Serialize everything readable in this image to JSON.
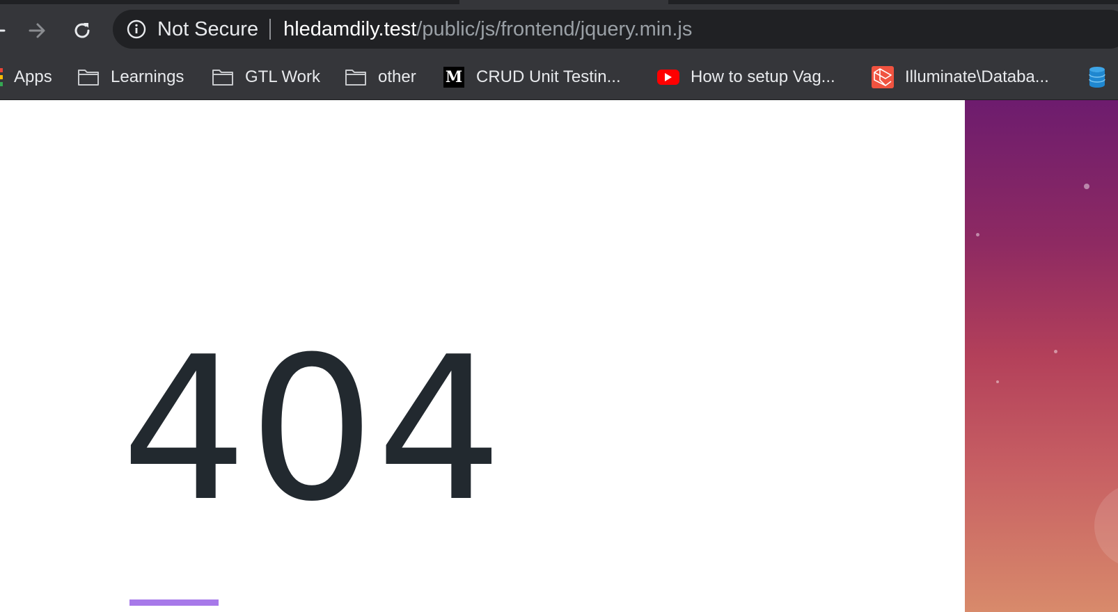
{
  "toolbar": {
    "security_label": "Not Secure",
    "url_host": "hledamdily.test",
    "url_path": "/public/js/frontend/jquery.min.js"
  },
  "bookmarks": {
    "apps": "Apps",
    "learnings": "Learnings",
    "gtl_work": "GTL Work",
    "other": "other",
    "crud": "CRUD Unit Testin...",
    "vagrant": "How to setup Vag...",
    "illuminate": "Illuminate\\Databa..."
  },
  "page": {
    "error_code": "404"
  },
  "icons": {
    "back": "back-arrow-icon",
    "forward": "forward-arrow-icon",
    "reload": "reload-icon",
    "info": "info-icon",
    "apps": "apps-grid-icon",
    "folder": "folder-icon",
    "medium": "medium-icon",
    "youtube": "youtube-icon",
    "laravel": "laravel-icon",
    "database": "database-icon"
  },
  "colors": {
    "chrome_toolbar": "#35363a",
    "omnibox": "#202124",
    "text_dark": "#22292f",
    "accent_underline": "#a779e9",
    "gradient_top": "#6d1c6e",
    "gradient_bottom": "#d88a6b"
  }
}
